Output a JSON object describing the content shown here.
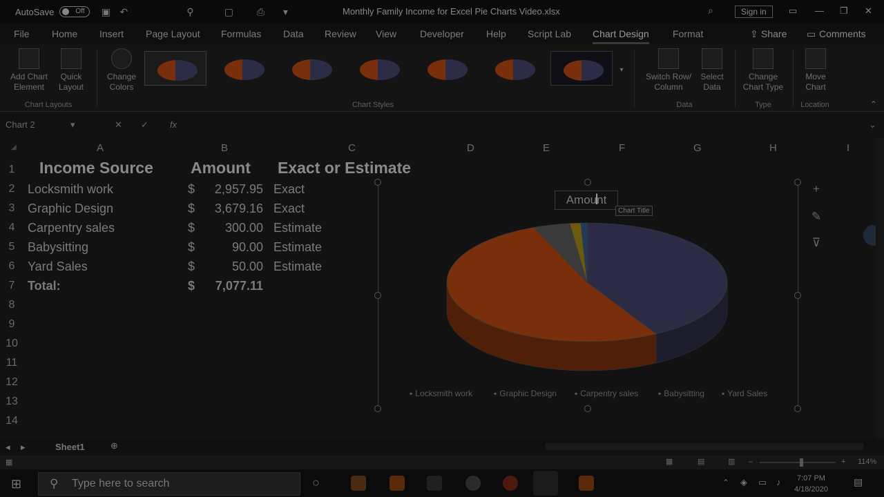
{
  "titlebar": {
    "autosave_label": "AutoSave",
    "toggle_state": "Off",
    "doc_title": "Monthly Family Income for Excel Pie Charts Video.xlsx",
    "signin_label": "Sign in"
  },
  "menu": {
    "tabs": [
      "File",
      "Home",
      "Insert",
      "Page Layout",
      "Formulas",
      "Data",
      "Review",
      "View",
      "Developer",
      "Help",
      "Script Lab",
      "Chart Design",
      "Format"
    ],
    "active_tab": "Chart Design",
    "share_label": "Share",
    "comments_label": "Comments"
  },
  "ribbon": {
    "add_chart_element": "Add Chart Element",
    "quick_layout": "Quick Layout",
    "change_colors": "Change Colors",
    "switch_row_column": "Switch Row/ Column",
    "select_data": "Select Data",
    "change_chart_type": "Change Chart Type",
    "move_chart": "Move Chart",
    "groups": {
      "chart_layouts": "Chart Layouts",
      "chart_styles": "Chart Styles",
      "data": "Data",
      "type": "Type",
      "location": "Location"
    }
  },
  "formula": {
    "name_box": "Chart 2",
    "fx": "fx"
  },
  "grid": {
    "columns": [
      "A",
      "B",
      "C",
      "D",
      "E",
      "F",
      "G",
      "H",
      "I"
    ],
    "rows": [
      "1",
      "2",
      "3",
      "4",
      "5",
      "6",
      "7",
      "8",
      "9",
      "10",
      "11",
      "12",
      "13",
      "14"
    ],
    "headers": {
      "income_source": "Income Source",
      "amount": "Amount",
      "exact_or_estimate": "Exact or Estimate"
    },
    "currency": "$",
    "data": [
      {
        "source": "Locksmith work",
        "amount": "2,957.95",
        "type": "Exact"
      },
      {
        "source": "Graphic Design",
        "amount": "3,679.16",
        "type": "Exact"
      },
      {
        "source": "Carpentry sales",
        "amount": "300.00",
        "type": "Estimate"
      },
      {
        "source": "Babysitting",
        "amount": "90.00",
        "type": "Estimate"
      },
      {
        "source": "Yard Sales",
        "amount": "50.00",
        "type": "Estimate"
      }
    ],
    "total_label": "Total:",
    "total_amount": "7,077.11"
  },
  "chart_data": {
    "type": "pie",
    "title": "Amount",
    "tooltip": "Chart Title",
    "categories": [
      "Locksmith work",
      "Graphic Design",
      "Carpentry sales",
      "Babysitting",
      "Yard Sales"
    ],
    "values": [
      2957.95,
      3679.16,
      300.0,
      90.0,
      50.0
    ],
    "colors": [
      "#2b2b45",
      "#7a2f0c",
      "#3a3a3a",
      "#6a5a10",
      "#1f3a5a"
    ],
    "legend_position": "bottom"
  },
  "sheet": {
    "tab_name": "Sheet1",
    "zoom": "114%"
  },
  "taskbar": {
    "search_placeholder": "Type here to search",
    "time": "7:07 PM",
    "date": "4/18/2020"
  }
}
